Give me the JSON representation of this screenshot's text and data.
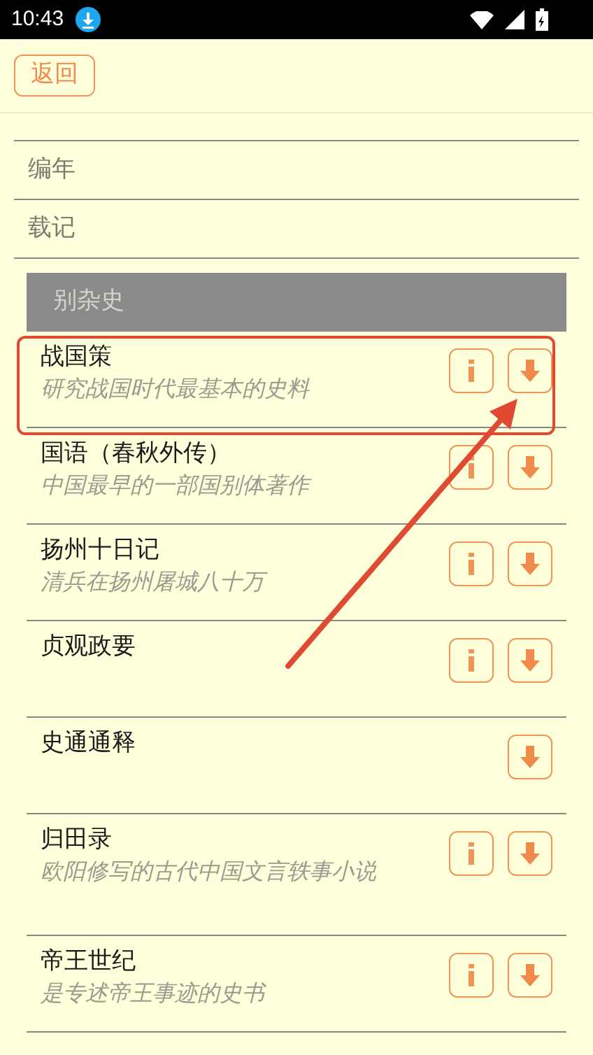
{
  "status_bar": {
    "time": "10:43"
  },
  "header": {
    "back_button": "返回"
  },
  "categories": [
    {
      "label": "编年"
    },
    {
      "label": "载记"
    }
  ],
  "section": {
    "title": "别杂史"
  },
  "items": [
    {
      "title": "战国策",
      "subtitle": "研究战国时代最基本的史料",
      "has_info": true,
      "highlighted": true
    },
    {
      "title": "国语（春秋外传）",
      "subtitle": "中国最早的一部国别体著作",
      "has_info": true,
      "highlighted": false
    },
    {
      "title": "扬州十日记",
      "subtitle": "清兵在扬州屠城八十万",
      "has_info": true,
      "highlighted": false
    },
    {
      "title": "贞观政要",
      "has_info": true,
      "highlighted": false
    },
    {
      "title": "史通通释",
      "has_info": false,
      "highlighted": false
    },
    {
      "title": "归田录",
      "subtitle": "欧阳修写的古代中国文言轶事小说",
      "has_info": true,
      "highlighted": false
    },
    {
      "title": "帝王世纪",
      "subtitle": "是专述帝王事迹的史书",
      "has_info": true,
      "highlighted": false
    }
  ]
}
